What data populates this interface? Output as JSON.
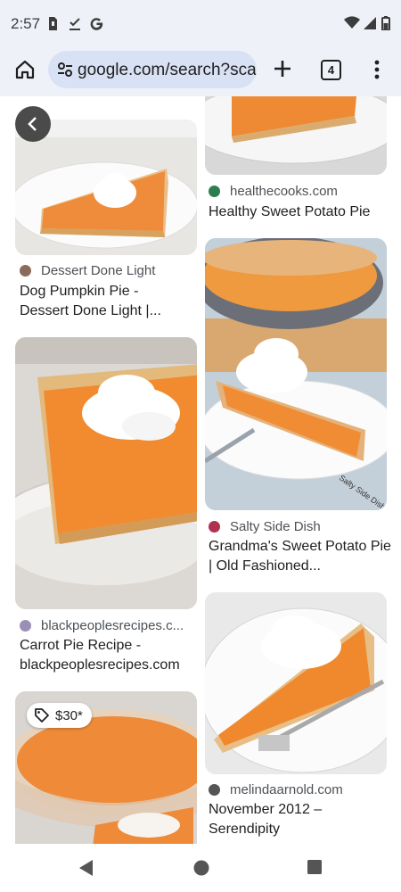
{
  "status_bar": {
    "time": "2:57",
    "icons": [
      "sim-icon",
      "download-done-icon",
      "google-icon",
      "wifi-icon",
      "signal-icon",
      "battery-icon"
    ]
  },
  "browser": {
    "url": "google.com/search?sca_",
    "tab_count": "4",
    "icons": [
      "home-icon",
      "site-settings-icon",
      "new-tab-icon",
      "tab-switcher-icon",
      "overflow-menu-icon"
    ]
  },
  "results": {
    "left": [
      {
        "source": "Dessert Done Light",
        "title": "Dog Pumpkin Pie - Dessert Done Light |...",
        "favicon_color": "#8a6b5c"
      },
      {
        "source": "blackpeoplesrecipes.c...",
        "title": "Carrot Pie Recipe - blackpeoplesrecipes.com",
        "favicon_color": "#9b8fb8"
      },
      {
        "price": "$30*"
      }
    ],
    "right": [
      {
        "source": "healthecooks.com",
        "title": "Healthy Sweet Potato Pie",
        "favicon_color": "#2e7d4f"
      },
      {
        "source": "Salty Side Dish",
        "title": "Grandma's Sweet Potato Pie | Old Fashioned...",
        "favicon_color": "#b03050",
        "watermark": "Salty Side Dish"
      },
      {
        "source": "melindaarnold.com",
        "title": "November 2012 – Serendipity",
        "favicon_color": "#555555"
      }
    ]
  },
  "nav": {
    "icons": [
      "back-nav-icon",
      "home-nav-icon",
      "recents-nav-icon"
    ]
  },
  "colors": {
    "chrome_bg": "#eef1f8",
    "url_bg": "#d9e2f5",
    "pie_orange": "#f0882f"
  }
}
